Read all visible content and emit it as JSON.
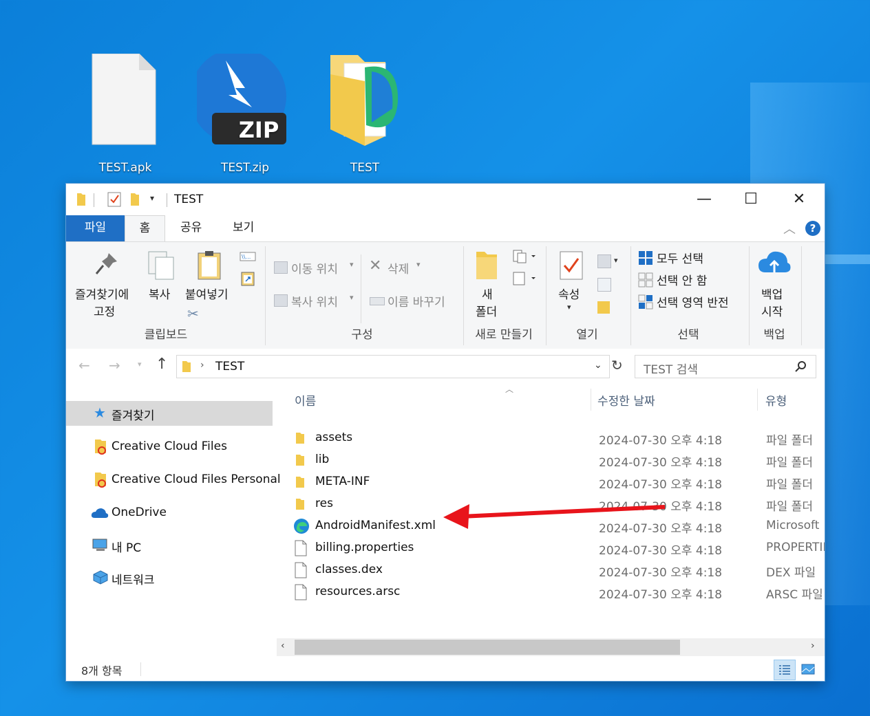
{
  "desktop": {
    "icons": [
      {
        "label": "TEST.apk",
        "icon": "document-icon"
      },
      {
        "label": "TEST.zip",
        "icon": "zip-archive-icon",
        "badge": "ZIP"
      },
      {
        "label": "TEST",
        "icon": "folder-icon"
      }
    ]
  },
  "window": {
    "title": "TEST",
    "tabs": [
      "파일",
      "홈",
      "공유",
      "보기"
    ],
    "ribbon": {
      "pin": [
        "즐겨찾기에",
        "고정"
      ],
      "copy": "복사",
      "paste": "붙여넣기",
      "clipboard_group": "클립보드",
      "move_to": "이동 위치",
      "copy_to": "복사 위치",
      "delete": "삭제",
      "rename": "이름 바꾸기",
      "organize_group": "구성",
      "new_folder": [
        "새",
        "폴더"
      ],
      "new_group": "새로 만들기",
      "properties": "속성",
      "open_group": "열기",
      "select_all": "모두 선택",
      "select_none": "선택 안 함",
      "invert_selection": "선택 영역 반전",
      "select_group": "선택",
      "backup": [
        "백업",
        "시작"
      ],
      "backup_group": "백업"
    },
    "address": {
      "path": "TEST",
      "search_placeholder": "TEST 검색"
    },
    "nav": [
      {
        "label": "즐겨찾기",
        "icon": "star-icon",
        "selected": true
      },
      {
        "label": "Creative Cloud Files",
        "icon": "creative-cloud-folder-icon"
      },
      {
        "label": "Creative Cloud Files Personal",
        "icon": "creative-cloud-folder-icon"
      },
      {
        "label": "OneDrive",
        "icon": "cloud-icon"
      },
      {
        "label": "내 PC",
        "icon": "computer-icon"
      },
      {
        "label": "네트워크",
        "icon": "network-icon"
      }
    ],
    "columns": {
      "name": "이름",
      "date": "수정한 날짜",
      "type": "유형"
    },
    "files": [
      {
        "name": "assets",
        "date": "2024-07-30 오후 4:18",
        "type": "파일 폴더",
        "icon": "folder"
      },
      {
        "name": "lib",
        "date": "2024-07-30 오후 4:18",
        "type": "파일 폴더",
        "icon": "folder"
      },
      {
        "name": "META-INF",
        "date": "2024-07-30 오후 4:18",
        "type": "파일 폴더",
        "icon": "folder"
      },
      {
        "name": "res",
        "date": "2024-07-30 오후 4:18",
        "type": "파일 폴더",
        "icon": "folder"
      },
      {
        "name": "AndroidManifest.xml",
        "date": "2024-07-30 오후 4:18",
        "type": "Microsoft",
        "icon": "edge"
      },
      {
        "name": "billing.properties",
        "date": "2024-07-30 오후 4:18",
        "type": "PROPERTIES",
        "icon": "file"
      },
      {
        "name": "classes.dex",
        "date": "2024-07-30 오후 4:18",
        "type": "DEX 파일",
        "icon": "file"
      },
      {
        "name": "resources.arsc",
        "date": "2024-07-30 오후 4:18",
        "type": "ARSC 파일",
        "icon": "file"
      }
    ],
    "status": "8개 항목"
  },
  "colors": {
    "accent": "#1f6fc5",
    "annotation_arrow": "#e8141b",
    "desktop": "#1591e8"
  }
}
